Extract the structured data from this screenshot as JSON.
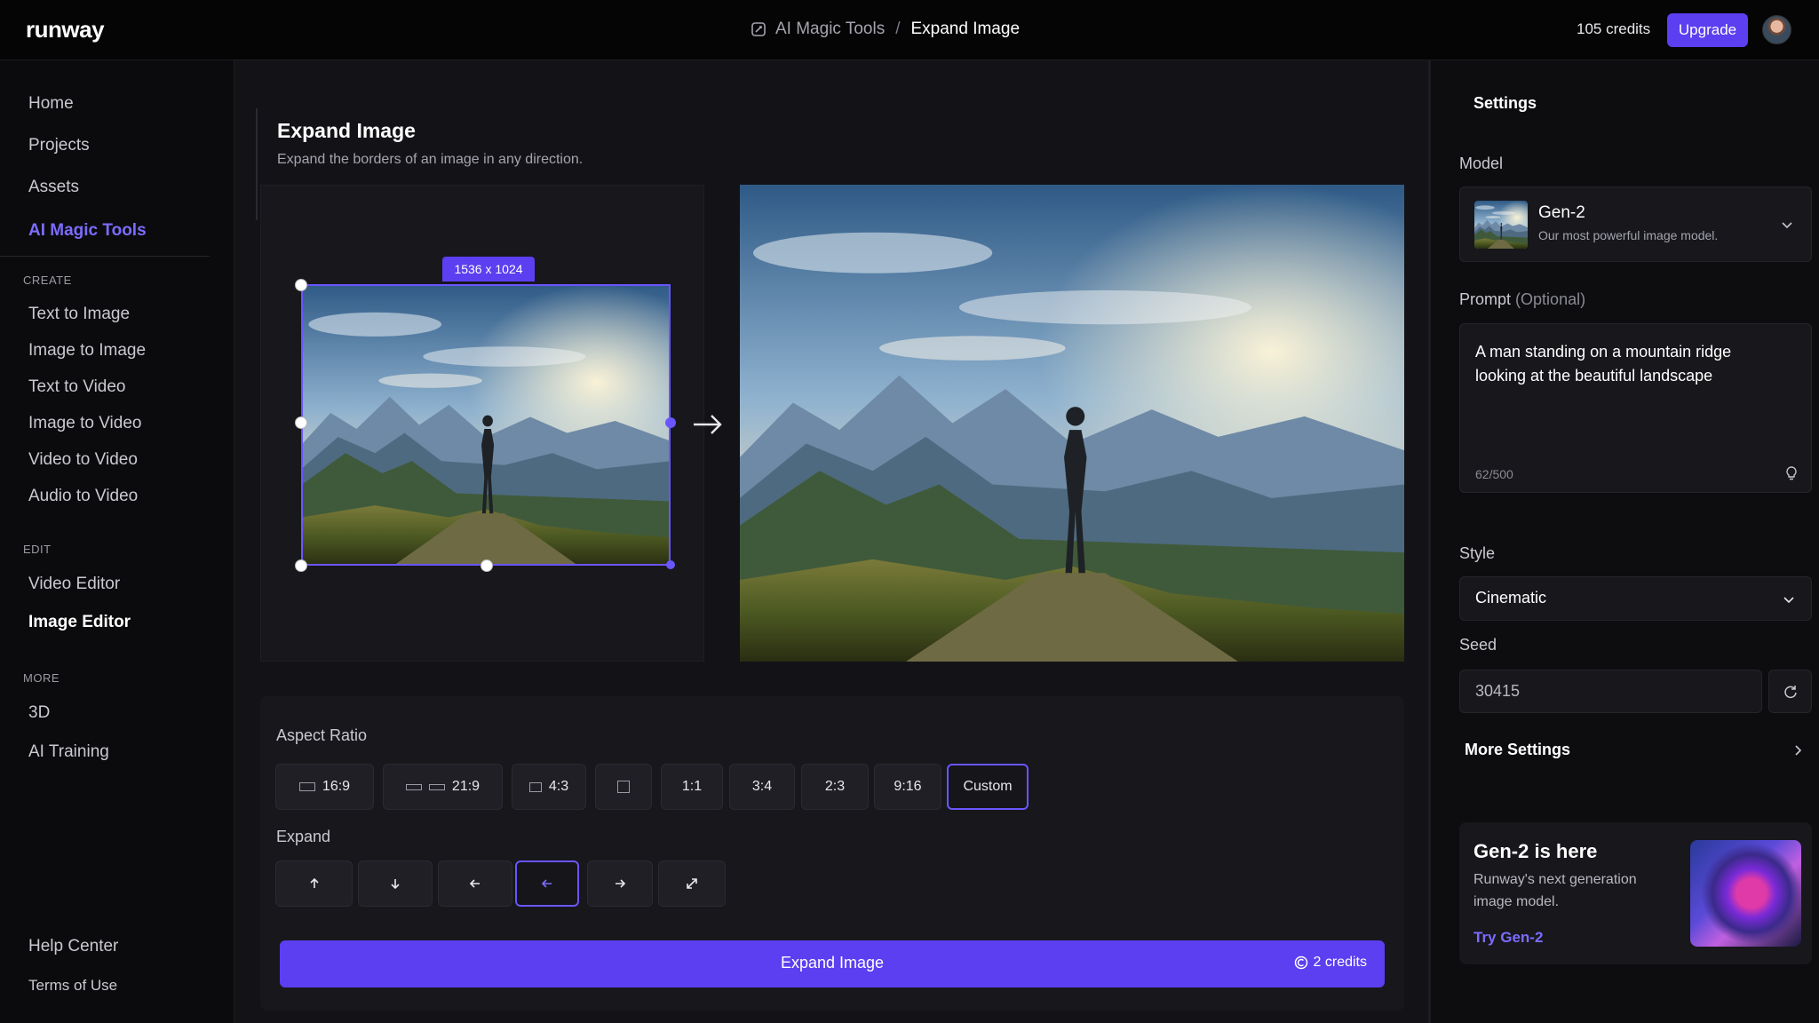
{
  "app": {
    "logo": "runway"
  },
  "breadcrumb": {
    "parent": "AI Magic Tools",
    "separator": "/",
    "current": "Expand Image"
  },
  "header": {
    "credits": "105 credits",
    "upgrade_label": "Upgrade"
  },
  "sidebar": {
    "top_items": [
      {
        "label": "Home"
      },
      {
        "label": "Projects"
      },
      {
        "label": "Assets"
      },
      {
        "label": "AI Magic Tools"
      }
    ],
    "create_label": "CREATE",
    "create_items": [
      {
        "label": "Text to Image"
      },
      {
        "label": "Image to Image"
      },
      {
        "label": "Text to Video"
      },
      {
        "label": "Image to Video"
      },
      {
        "label": "Video to Video"
      },
      {
        "label": "Audio to Video"
      }
    ],
    "edit_label": "EDIT",
    "edit_items": [
      {
        "label": "Video Editor"
      },
      {
        "label": "Image Editor"
      }
    ],
    "more_label": "MORE",
    "more_items": [
      {
        "label": "3D"
      },
      {
        "label": "AI Training"
      }
    ],
    "bottom_items": [
      {
        "label": "Help Center"
      },
      {
        "label": "Terms of Use"
      }
    ]
  },
  "main": {
    "title": "Expand Image",
    "subtitle": "Expand the borders of an image in any direction.",
    "selection_size": "1536 x 1024",
    "aspect_ratio_label": "Aspect Ratio",
    "aspect_ratios": [
      "16:9",
      "21:9",
      "4:3",
      "",
      "1:1",
      "3:4",
      "2:3",
      "9:16",
      "Custom"
    ],
    "selected_ratio": "Custom",
    "expand_label": "Expand",
    "expand_directions": [
      "up-arrow-icon",
      "down-arrow-icon",
      "left-arrow-icon",
      "left-arrow-icon",
      "right-arrow-icon",
      "expand-all-icon"
    ],
    "selected_direction_index": 3,
    "expand_button": "Expand Image",
    "expand_cost": "2 credits"
  },
  "settings": {
    "title": "Settings",
    "model_label": "Model",
    "model_name": "Gen-2",
    "model_desc": "Our most powerful image model.",
    "prompt_label": "Prompt",
    "prompt_optional": "(Optional)",
    "prompt_text": "A man standing on a mountain ridge looking at the beautiful landscape",
    "prompt_count": "62/500",
    "style_label": "Style",
    "style_value": "Cinematic",
    "seed_label": "Seed",
    "seed_value": "30415",
    "more_settings": "More Settings",
    "promo_title": "Gen-2 is here",
    "promo_desc": "Runway's next generation image model.",
    "promo_link": "Try Gen-2"
  },
  "colors": {
    "accent": "#5b3ff0",
    "accent_text": "#7c6cff",
    "background": "#131317",
    "panel": "#17171c"
  }
}
